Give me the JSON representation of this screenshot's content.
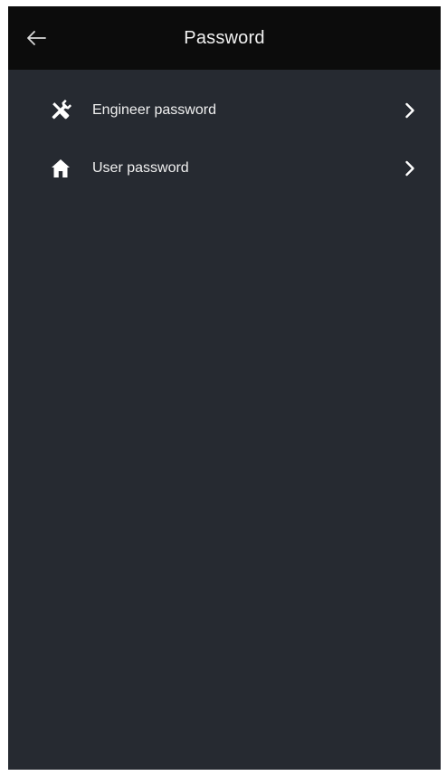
{
  "header": {
    "title": "Password",
    "back_icon": "arrow-left-icon"
  },
  "menu": {
    "items": [
      {
        "label": "Engineer password",
        "icon": "tools-icon"
      },
      {
        "label": "User password",
        "icon": "home-icon"
      }
    ]
  },
  "colors": {
    "app_bar": "#0c0c0c",
    "background": "#262a31",
    "text": "#f0f0f0"
  }
}
